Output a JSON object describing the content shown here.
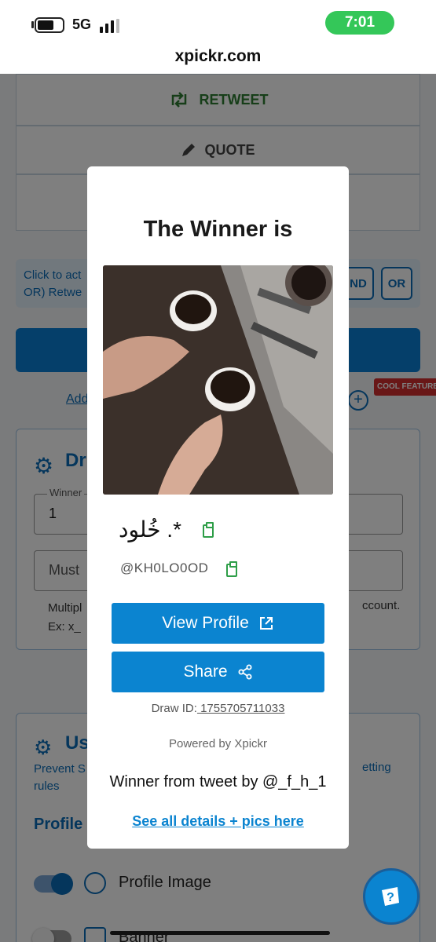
{
  "status_bar": {
    "network": "5G",
    "time": "7:01"
  },
  "browser": {
    "url": "xpickr.com"
  },
  "background": {
    "retweet_label": "RETWEET",
    "quote_label": "QUOTE",
    "hint_line1": "Click to act",
    "hint_line2": "OR) Retwe",
    "and_label": "ND",
    "or_label": "OR",
    "add_link": "Add",
    "cool_feature": "COOL FEATURE",
    "draw_title": "Dr",
    "winners_label": "Winner",
    "winners_value": "1",
    "must_value": "Must",
    "multi_line1": "Multipl",
    "multi_line2": "Ex: x_",
    "account_text": "ccount.",
    "user_title": "Us",
    "prevent_line1": "Prevent S",
    "prevent_line2": "rules",
    "getting_text": "etting",
    "profile_heading": "Profile",
    "options": [
      {
        "label": "Profile Image",
        "enabled": true
      },
      {
        "label": "Banner",
        "enabled": false
      }
    ]
  },
  "modal": {
    "title": "The Winner is",
    "display_name": "خُلود .*",
    "handle": "@KH0LO0OD",
    "view_profile_label": "View Profile",
    "share_label": "Share",
    "draw_id_label": "Draw ID:",
    "draw_id_value": " 1755705711033",
    "powered_by": "Powered by Xpickr",
    "from_tweet": "Winner from tweet by @_f_h_1",
    "details_link": "See all details + pics here"
  },
  "colors": {
    "primary": "#0b84d0",
    "retweet_green": "#2e7d32",
    "copy_green": "#2e9e48",
    "status_pill": "#34c759",
    "cool_badge": "#d32f2f"
  },
  "icons": [
    "battery-icon",
    "signal-icon",
    "retweet-icon",
    "pencil-icon",
    "gear-icon",
    "user-gear-icon",
    "copy-icon",
    "external-link-icon",
    "share-icon",
    "help-icon"
  ]
}
